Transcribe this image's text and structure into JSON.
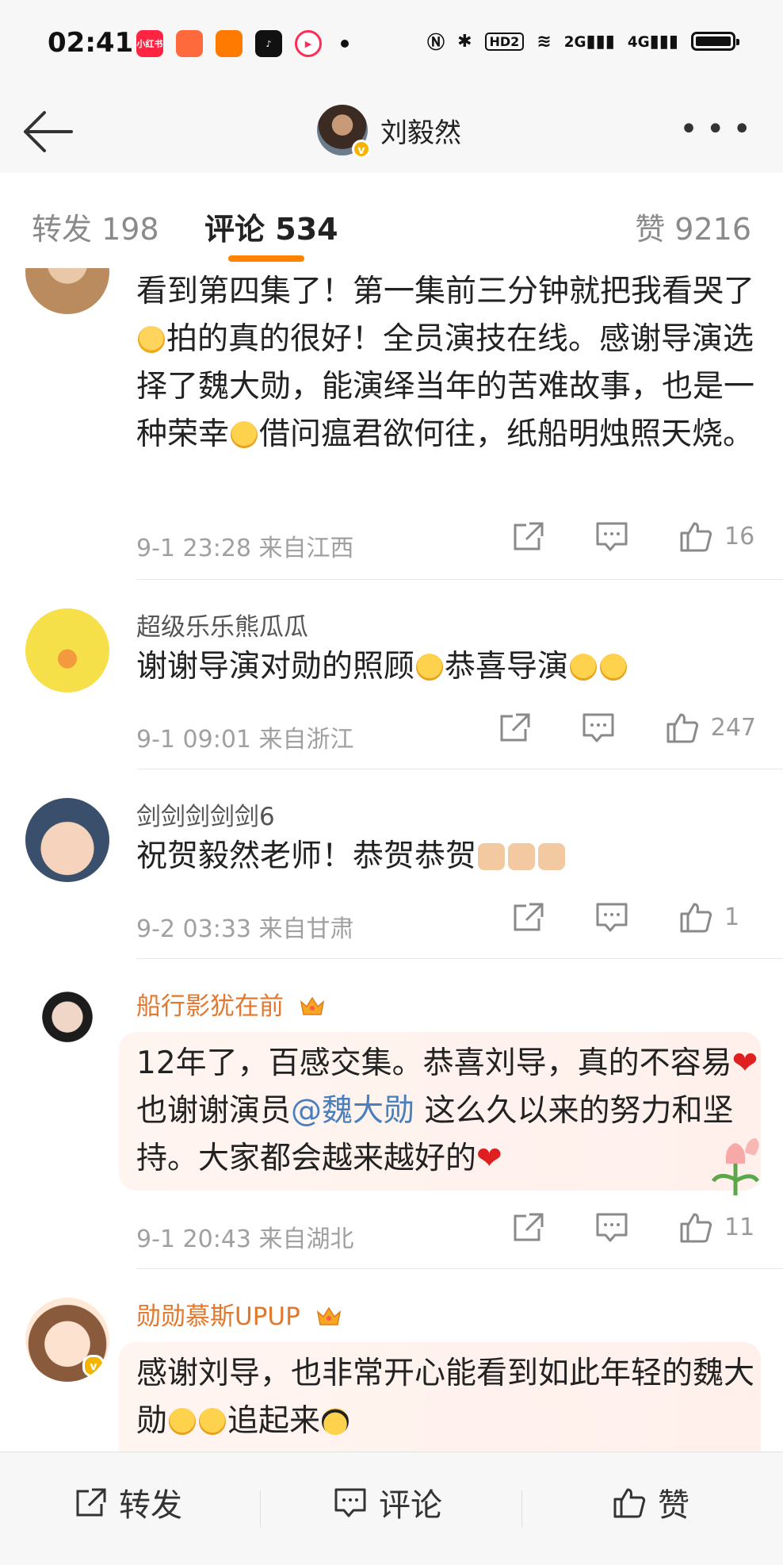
{
  "status_bar": {
    "time": "02:41",
    "apps": [
      {
        "name": "小红书",
        "color": "#ff2442"
      },
      {
        "name": "",
        "color": "#ff6a3d"
      },
      {
        "name": "",
        "color": "#ff7a00"
      },
      {
        "name": "",
        "color": "#111111"
      },
      {
        "name": "",
        "color": "#ff2d55"
      }
    ],
    "hd_label": "HD2",
    "net1": "2G",
    "net2": "4G"
  },
  "header": {
    "title": "刘毅然"
  },
  "tabs": {
    "repost": "转发 198",
    "comment_label": "评论",
    "comment_count": "534",
    "like": "赞 9216"
  },
  "comments": [
    {
      "text_parts": [
        "看到第四集了！第一集前三分钟就把我看哭了",
        "拍的真的很好！全员演技在线。感谢导演选择了魏大勋，能演绎当年的苦难故事，也是一种荣幸",
        "借问瘟君欲何往，纸船明烛照天烧。"
      ],
      "time": "9-1 23:28",
      "location": "来自江西",
      "likes": "16"
    },
    {
      "name": "超级乐乐熊瓜瓜",
      "text": "谢谢导演对勋的照顾",
      "text_b": "恭喜导演",
      "time": "9-1 09:01",
      "location": "来自浙江",
      "likes": "247"
    },
    {
      "name": "剑剑剑剑剑6",
      "text": "祝贺毅然老师！恭贺恭贺",
      "time": "9-2 03:33",
      "location": "来自甘肃",
      "likes": "1"
    },
    {
      "name": "船行影犹在前",
      "text_a": "12年了，百感交集。恭喜刘导，真的不容易",
      "text_b": "也谢谢演员",
      "mention": "@魏大勋",
      "text_c": "这么久以来的努力和坚持。大家都会越来越好的",
      "time": "9-1 20:43",
      "location": "来自湖北",
      "likes": "11"
    },
    {
      "name": "勋勋慕斯UPUP",
      "text_a": "感谢刘导，也非常开心能看到如此年轻的魏大勋",
      "text_b": "追起来"
    }
  ],
  "bottom_bar": {
    "repost": "转发",
    "comment": "评论",
    "like": "赞"
  },
  "colors": {
    "accent": "#ff8200",
    "vip_name": "#e2782d",
    "mention": "#4a7fbd"
  },
  "icons": [
    "back-arrow-icon",
    "more-icon",
    "share-icon",
    "comment-icon",
    "like-icon",
    "crown-icon",
    "verified-icon"
  ]
}
